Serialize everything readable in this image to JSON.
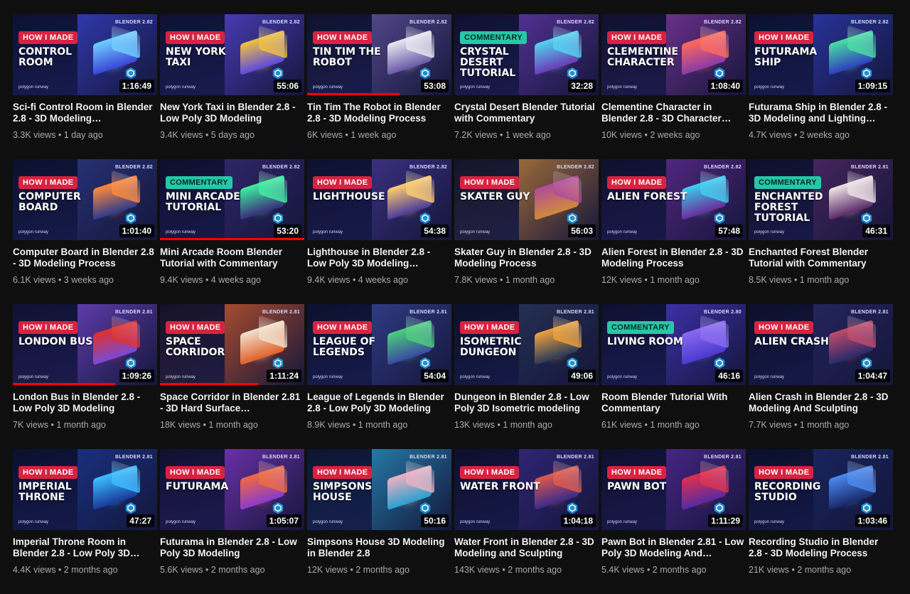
{
  "videos": [
    {
      "badge": "HOW I MADE",
      "badge_type": "made",
      "thumb_title": "CONTROL ROOM",
      "version": "BLENDER 2.82",
      "brand": "polygon runway",
      "duration": "1:16:49",
      "title": "Sci-fi Control Room in Blender 2.8 - 3D Modeling…",
      "views": "3.3K views",
      "age": "1 day ago",
      "accent": "#3b46d6",
      "progress": 0,
      "color": "#6fd0ff"
    },
    {
      "badge": "HOW I MADE",
      "badge_type": "made",
      "thumb_title": "NEW YORK TAXI",
      "version": "BLENDER 2.82",
      "brand": "polygon runway",
      "duration": "55:06",
      "title": "New York Taxi in Blender 2.8 - Low Poly 3D Modeling",
      "views": "3.4K views",
      "age": "5 days ago",
      "accent": "#5b49e0",
      "progress": 0,
      "color": "#f2c23a"
    },
    {
      "badge": "HOW I MADE",
      "badge_type": "made",
      "thumb_title": "TIN TIM THE ROBOT",
      "version": "BLENDER 2.82",
      "brand": "polygon runway",
      "duration": "53:08",
      "title": "Tin Tim The Robot in Blender 2.8 - 3D Modeling Process",
      "views": "6K views",
      "age": "1 week ago",
      "accent": "#6a5aa8",
      "progress": 0.64,
      "color": "#e8e8f0"
    },
    {
      "badge": "COMMENTARY",
      "badge_type": "comm",
      "thumb_title": "CRYSTAL DESERT TUTORIAL",
      "version": "BLENDER 2.82",
      "brand": "polygon runway",
      "duration": "32:28",
      "title": "Crystal Desert Blender Tutorial with Commentary",
      "views": "7.2K views",
      "age": "1 week ago",
      "accent": "#6b3bb6",
      "progress": 0,
      "color": "#4fd6f0"
    },
    {
      "badge": "HOW I MADE",
      "badge_type": "made",
      "thumb_title": "CLEMENTINE CHARACTER",
      "version": "BLENDER 2.82",
      "brand": "polygon runway",
      "duration": "1:08:40",
      "title": "Clementine Character in Blender 2.8 - 3D Character…",
      "views": "10K views",
      "age": "2 weeks ago",
      "accent": "#8c3aa8",
      "progress": 0,
      "color": "#ff6a5a"
    },
    {
      "badge": "HOW I MADE",
      "badge_type": "made",
      "thumb_title": "FUTURAMA SHIP",
      "version": "BLENDER 2.82",
      "brand": "polygon runway",
      "duration": "1:09:15",
      "title": "Futurama Ship in Blender 2.8 - 3D Modeling and Lighting…",
      "views": "4.7K views",
      "age": "2 weeks ago",
      "accent": "#2f3fbf",
      "progress": 0,
      "color": "#48e0a0"
    },
    {
      "badge": "HOW I MADE",
      "badge_type": "made",
      "thumb_title": "COMPUTER BOARD",
      "version": "BLENDER 2.82",
      "brand": "polygon runway",
      "duration": "1:01:40",
      "title": "Computer Board in Blender 2.8 - 3D Modeling Process",
      "views": "6.1K views",
      "age": "3 weeks ago",
      "accent": "#2e3b8a",
      "progress": 0,
      "color": "#ff8a3a"
    },
    {
      "badge": "COMMENTARY",
      "badge_type": "comm",
      "thumb_title": "MINI ARCADE TUTORIAL",
      "version": "BLENDER 2.82",
      "brand": "polygon runway",
      "duration": "53:20",
      "title": "Mini Arcade Room Blender Tutorial with Commentary",
      "views": "9.4K views",
      "age": "4 weeks ago",
      "accent": "#3a2c7a",
      "progress": 1,
      "color": "#3ef0a0"
    },
    {
      "badge": "HOW I MADE",
      "badge_type": "made",
      "thumb_title": "LIGHTHOUSE",
      "version": "BLENDER 2.82",
      "brand": "polygon runway",
      "duration": "54:38",
      "title": "Lighthouse in Blender 2.8 - Low Poly 3D Modeling…",
      "views": "9.4K views",
      "age": "4 weeks ago",
      "accent": "#4a3a9a",
      "progress": 0,
      "color": "#ffcf6a"
    },
    {
      "badge": "HOW I MADE",
      "badge_type": "made",
      "thumb_title": "SKATER GUY",
      "version": "BLENDER 2.82",
      "brand": "polygon runway",
      "duration": "56:03",
      "title": "Skater Guy in Blender 2.8 - 3D Modeling Process",
      "views": "7.8K views",
      "age": "1 month ago",
      "accent": "#d08a3a",
      "progress": 0,
      "color": "#b04a9a"
    },
    {
      "badge": "HOW I MADE",
      "badge_type": "made",
      "thumb_title": "ALIEN FOREST",
      "version": "BLENDER 2.82",
      "brand": "polygon runway",
      "duration": "57:48",
      "title": "Alien Forest in Blender 2.8 - 3D Modeling Process",
      "views": "12K views",
      "age": "1 month ago",
      "accent": "#6a2c9a",
      "progress": 0,
      "color": "#3ad0f0"
    },
    {
      "badge": "COMMENTARY",
      "badge_type": "comm",
      "thumb_title": "ENCHANTED FOREST TUTORIAL",
      "version": "BLENDER 2.81",
      "brand": "polygon runway",
      "duration": "46:31",
      "title": "Enchanted Forest Blender Tutorial with Commentary",
      "views": "8.5K views",
      "age": "1 month ago",
      "accent": "#5a2a6a",
      "progress": 0,
      "color": "#f0e6e6"
    },
    {
      "badge": "HOW I MADE",
      "badge_type": "made",
      "thumb_title": "LONDON BUS",
      "version": "BLENDER 2.81",
      "brand": "polygon runway",
      "duration": "1:09:26",
      "title": "London Bus in Blender 2.8 - Low Poly 3D Modeling",
      "views": "7K views",
      "age": "1 month ago",
      "accent": "#7a4ad6",
      "progress": 0.71,
      "color": "#e0302a"
    },
    {
      "badge": "HOW I MADE",
      "badge_type": "made",
      "thumb_title": "SPACE CORRIDOR",
      "version": "BLENDER 2.81",
      "brand": "polygon runway",
      "duration": "1:11:24",
      "title": "Space Corridor in Blender 2.81 - 3D Hard Surface…",
      "views": "18K views",
      "age": "1 month ago",
      "accent": "#e2602a",
      "progress": 0.68,
      "color": "#f0e2d0"
    },
    {
      "badge": "HOW I MADE",
      "badge_type": "made",
      "thumb_title": "LEAGUE OF LEGENDS",
      "version": "BLENDER 2.81",
      "brand": "polygon runway",
      "duration": "54:04",
      "title": "League of Legends in Blender 2.8 - Low Poly 3D Modeling",
      "views": "8.9K views",
      "age": "1 month ago",
      "accent": "#3a4aa0",
      "progress": 0,
      "color": "#4ad07a"
    },
    {
      "badge": "HOW I MADE",
      "badge_type": "made",
      "thumb_title": "ISOMETRIC DUNGEON",
      "version": "BLENDER 2.81",
      "brand": "polygon runway",
      "duration": "49:06",
      "title": "Dungeon in Blender 2.8 - Low Poly 3D Isometric modeling",
      "views": "13K views",
      "age": "1 month ago",
      "accent": "#2a3a5a",
      "progress": 0,
      "color": "#f0a03a"
    },
    {
      "badge": "COMMENTARY",
      "badge_type": "comm",
      "thumb_title": "LIVING ROOM",
      "version": "BLENDER 2.80",
      "brand": "polygon runway",
      "duration": "46:16",
      "title": "Room Blender Tutorial With Commentary",
      "views": "61K views",
      "age": "1 month ago",
      "accent": "#4a3ad0",
      "progress": 0,
      "color": "#8a6af0"
    },
    {
      "badge": "HOW I MADE",
      "badge_type": "made",
      "thumb_title": "ALIEN CRASH",
      "version": "BLENDER 2.81",
      "brand": "polygon runway",
      "duration": "1:04:47",
      "title": "Alien Crash in Blender 2.8 - 3D Modeling And Sculpting",
      "views": "7.7K views",
      "age": "1 month ago",
      "accent": "#2a2a6a",
      "progress": 0,
      "color": "#c04a6a"
    },
    {
      "badge": "HOW I MADE",
      "badge_type": "made",
      "thumb_title": "IMPERIAL THRONE",
      "version": "BLENDER 2.81",
      "brand": "polygon runway",
      "duration": "47:27",
      "title": "Imperial Throne Room in Blender 2.8 - Low Poly 3D…",
      "views": "4.4K views",
      "age": "2 months ago",
      "accent": "#1a3a9a",
      "progress": 0,
      "color": "#3ac0ff"
    },
    {
      "badge": "HOW I MADE",
      "badge_type": "made",
      "thumb_title": "FUTURAMA",
      "version": "BLENDER 2.81",
      "brand": "polygon runway",
      "duration": "1:05:07",
      "title": "Futurama in Blender 2.8 - Low Poly 3D Modeling",
      "views": "5.6K views",
      "age": "2 months ago",
      "accent": "#8a3ad0",
      "progress": 0,
      "color": "#f06a3a"
    },
    {
      "badge": "HOW I MADE",
      "badge_type": "made",
      "thumb_title": "SIMPSONS HOUSE",
      "version": "BLENDER 2.81",
      "brand": "polygon runway",
      "duration": "50:16",
      "title": "Simpsons House 3D Modeling in Blender 2.8",
      "views": "12K views",
      "age": "2 months ago",
      "accent": "#2aa0d0",
      "progress": 0,
      "color": "#f0b0c0"
    },
    {
      "badge": "HOW I MADE",
      "badge_type": "made",
      "thumb_title": "WATER FRONT",
      "version": "BLENDER 2.81",
      "brand": "polygon runway",
      "duration": "1:04:18",
      "title": "Water Front in Blender 2.8 - 3D Modeling and Sculpting",
      "views": "143K views",
      "age": "2 months ago",
      "accent": "#3a2a8a",
      "progress": 0,
      "color": "#e05a4a"
    },
    {
      "badge": "HOW I MADE",
      "badge_type": "made",
      "thumb_title": "PAWN BOT",
      "version": "BLENDER 2.81",
      "brand": "polygon runway",
      "duration": "1:11:29",
      "title": "Pawn Bot in Blender 2.81 - Low Poly 3D Modeling And…",
      "views": "5.4K views",
      "age": "2 months ago",
      "accent": "#5a2aa0",
      "progress": 0,
      "color": "#e0304a"
    },
    {
      "badge": "HOW I MADE",
      "badge_type": "made",
      "thumb_title": "RECORDING STUDIO",
      "version": "BLENDER 2.81",
      "brand": "polygon runway",
      "duration": "1:03:46",
      "title": "Recording Studio in Blender 2.8 - 3D Modeling Process",
      "views": "21K views",
      "age": "2 months ago",
      "accent": "#1a2a6a",
      "progress": 0,
      "color": "#4a8af0"
    }
  ],
  "separator": "•"
}
